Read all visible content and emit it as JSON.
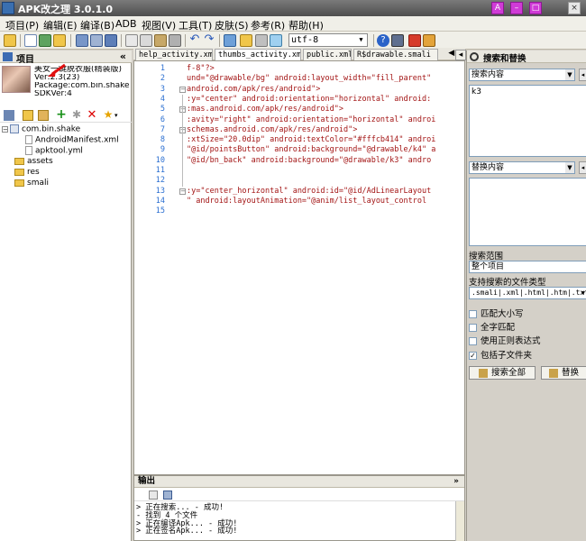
{
  "titlebar": {
    "title": "APK改之理 3.0.1.0"
  },
  "menu": [
    "项目(P)",
    "编辑(E)",
    "编译(B)",
    "ADB",
    "视图(V)",
    "工具(T)",
    "皮肤(S)",
    "参考(R)",
    "帮助(H)"
  ],
  "toolbar": {
    "encoding": "utf-8"
  },
  "left_panel": {
    "title": "项目",
    "collapse": "«",
    "app": {
      "name": "美女一键脱衣服(精装版)",
      "ver": "Ver:2.3(23)",
      "package": "Package:com.bin.shake",
      "sdk": "SDKVer:4"
    },
    "tree": [
      {
        "label": "com.bin.shake",
        "kind": "pkg"
      },
      {
        "label": "AndroidManifest.xml",
        "kind": "file"
      },
      {
        "label": "apktool.yml",
        "kind": "file"
      },
      {
        "label": "assets",
        "kind": "folder"
      },
      {
        "label": "res",
        "kind": "folder"
      },
      {
        "label": "smali",
        "kind": "folder"
      }
    ]
  },
  "tabs": [
    {
      "label": "help_activity.xml",
      "close": "×"
    },
    {
      "label": "thumbs_activity.xml",
      "close": "×"
    },
    {
      "label": "public.xml",
      "close": "×"
    },
    {
      "label": "R$drawable.smali",
      "close": ""
    }
  ],
  "editor": {
    "line_numbers": [
      "1",
      "2",
      "3",
      "4",
      "5",
      "6",
      "7",
      "8",
      "9",
      "10",
      "11",
      "12",
      "13",
      "14",
      "15"
    ],
    "lines": [
      "f-8\"?>",
      "und=\"@drawable/bg\" android:layout_width=\"fill_parent\"",
      " android.com/apk/res/android\">",
      ":y=\"center\" android:orientation=\"horizontal\" android:",
      ":mas.android.com/apk/res/android\">",
      ":avity=\"right\" android:orientation=\"horizontal\" androi",
      " schemas.android.com/apk/res/android\">",
      ":xtSize=\"20.0dip\" android:textColor=\"#fffcb414\" androi",
      " \"@id/pointsButton\" android:background=\"@drawable/k4\" a",
      " \"@id/bn_back\" android:background=\"@drawable/k3\" andro",
      "",
      "",
      ":y=\"center_horizontal\" android:id=\"@id/AdLinearLayout",
      " \" android:layoutAnimation=\"@anim/list_layout_control",
      ""
    ]
  },
  "output": {
    "title": "输出",
    "chevron": "»",
    "lines": [
      "> 正在搜索... - 成功!",
      "  - 找到 4 个文件",
      "> 正在编译Apk... - 成功!",
      "> 正在签名Apk... - 成功!"
    ]
  },
  "search_panel": {
    "title": "搜索和替换",
    "search_label": "搜索内容",
    "search_value": "k3",
    "replace_label": "替换内容",
    "scope_label": "搜索范围",
    "scope_value": "整个项目",
    "filetypes_label": "支持搜索的文件类型",
    "filetypes_value": ".smali|.xml|.html|.htm|.txt",
    "options": [
      {
        "label": "匹配大小写",
        "checked": false
      },
      {
        "label": "全字匹配",
        "checked": false
      },
      {
        "label": "使用正则表达式",
        "checked": false
      },
      {
        "label": "包括子文件夹",
        "checked": true
      }
    ],
    "search_all_button": "搜索全部",
    "replace_button": "替换"
  }
}
